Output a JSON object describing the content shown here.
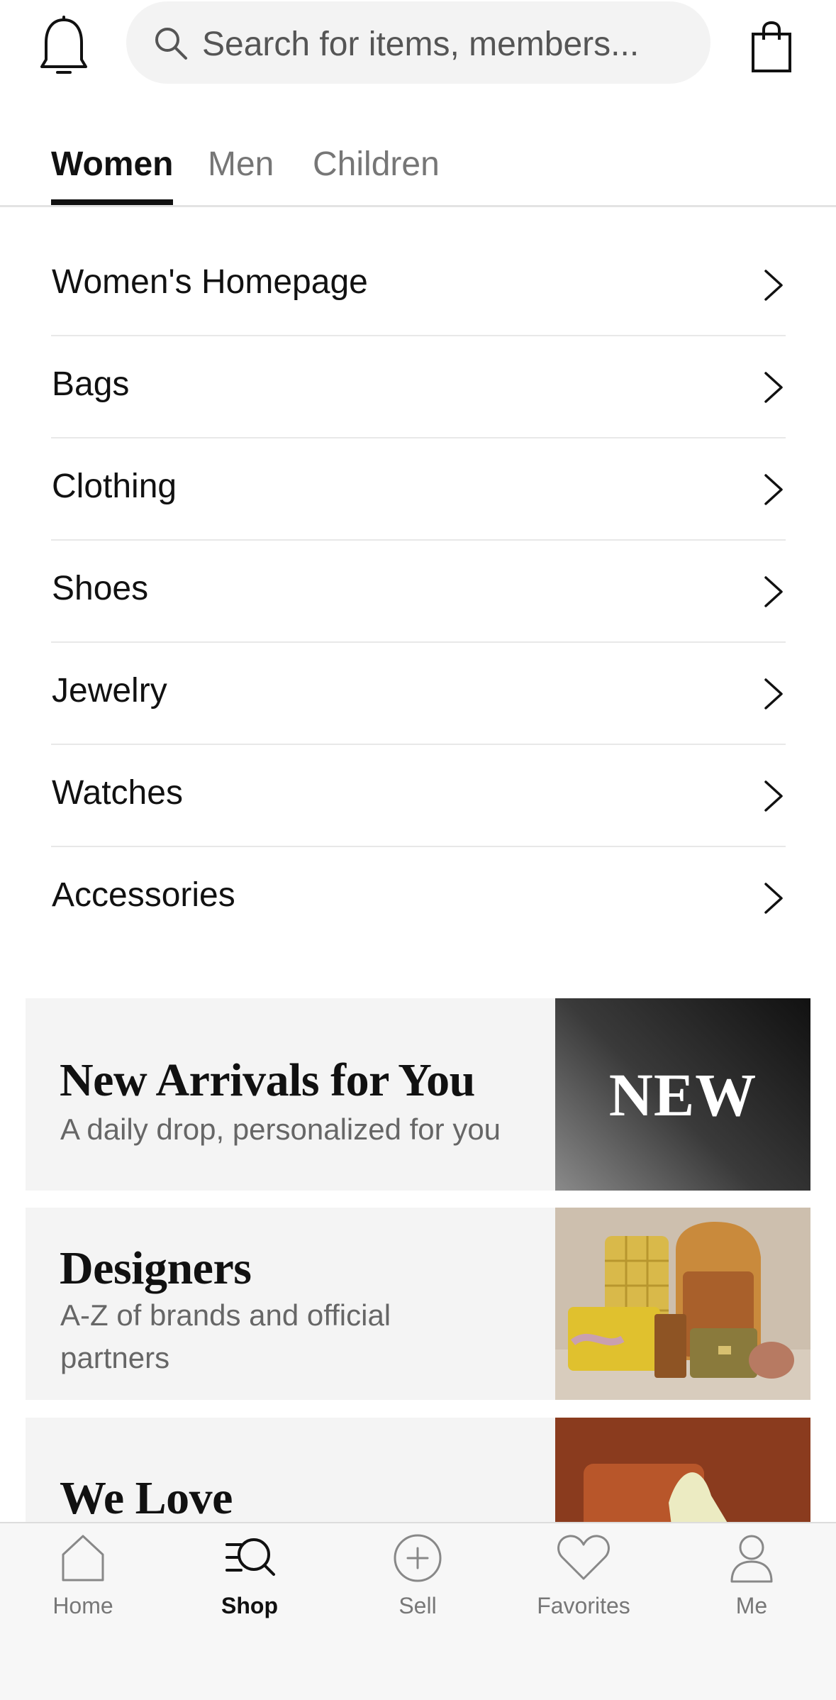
{
  "header": {
    "search_placeholder": "Search for items, members...",
    "bell_icon": "bell-icon",
    "bag_icon": "shopping-bag-icon"
  },
  "tabs": [
    {
      "label": "Women",
      "active": true
    },
    {
      "label": "Men",
      "active": false
    },
    {
      "label": "Children",
      "active": false
    }
  ],
  "categories": [
    {
      "label": "Women's Homepage"
    },
    {
      "label": "Bags"
    },
    {
      "label": "Clothing"
    },
    {
      "label": "Shoes"
    },
    {
      "label": "Jewelry"
    },
    {
      "label": "Watches"
    },
    {
      "label": "Accessories"
    }
  ],
  "promos": [
    {
      "title": "New Arrivals for You",
      "subtitle": "A daily drop, personalized for you",
      "badge": "NEW"
    },
    {
      "title": "Designers",
      "subtitle": "A-Z of brands and official partners"
    },
    {
      "title": "We Love",
      "subtitle": ""
    }
  ],
  "bottom_nav": [
    {
      "label": "Home",
      "icon": "home-icon",
      "active": false
    },
    {
      "label": "Shop",
      "icon": "shop-search-icon",
      "active": true
    },
    {
      "label": "Sell",
      "icon": "plus-circle-icon",
      "active": false
    },
    {
      "label": "Favorites",
      "icon": "heart-icon",
      "active": false
    },
    {
      "label": "Me",
      "icon": "person-icon",
      "active": false
    }
  ],
  "colors": {
    "text_primary": "#111111",
    "text_secondary": "#767676",
    "card_bg": "#f4f4f4",
    "nav_bg": "#f7f7f7"
  }
}
